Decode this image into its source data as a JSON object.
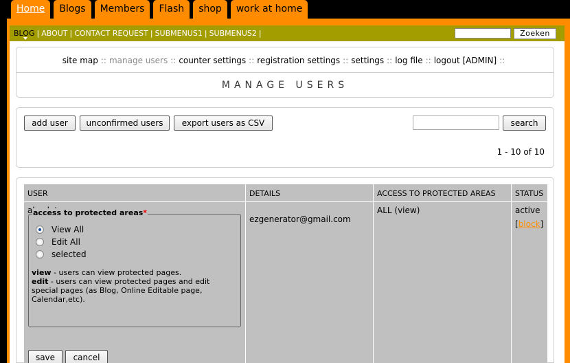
{
  "tabs": [
    {
      "label": "Home",
      "active": true
    },
    {
      "label": "Blogs"
    },
    {
      "label": "Members"
    },
    {
      "label": "Flash"
    },
    {
      "label": "shop"
    },
    {
      "label": "work at home"
    }
  ],
  "subnav": {
    "items": [
      "BLOG",
      "ABOUT",
      "CONTACT REQUEST",
      "SUBMENUS1",
      "SUBMENUS2"
    ],
    "separator": "|",
    "search_button": "Zoeken"
  },
  "admin_menu": {
    "links": [
      "site map",
      "manage users",
      "counter settings",
      "registration settings",
      "settings",
      "log file",
      "logout [ADMIN]"
    ],
    "separator": "::",
    "title": "MANAGE USERS"
  },
  "actions": {
    "add_user": "add user",
    "unconfirmed_users": "unconfirmed users",
    "export_csv": "export users as CSV",
    "search_button": "search",
    "pager": "1 - 10 of 10"
  },
  "table": {
    "headers": [
      "USER",
      "DETAILS",
      "ACCESS TO PROTECTED AREAS",
      "STATUS"
    ],
    "row": {
      "user": "absolut",
      "details": "ezgenerator@gmail.com",
      "access": "ALL (view)",
      "status": "active",
      "block_link": "block",
      "block_open": "[",
      "block_close": "]"
    },
    "access_form": {
      "legend": "access to protected areas",
      "required_mark": "*",
      "options": [
        "View All",
        "Edit All",
        "selected"
      ],
      "help_view_term": "view",
      "help_view_text": " - users can view protected pages.",
      "help_edit_term": "edit",
      "help_edit_text": " - users can view protected pages and edit special pages (as Blog, Online Editable page, Calendar,etc).",
      "save": "save",
      "cancel": "cancel"
    }
  },
  "colors": {
    "tab": "#ff8c00",
    "subnav": "#a39d00",
    "grid": "#c0c0c0"
  }
}
